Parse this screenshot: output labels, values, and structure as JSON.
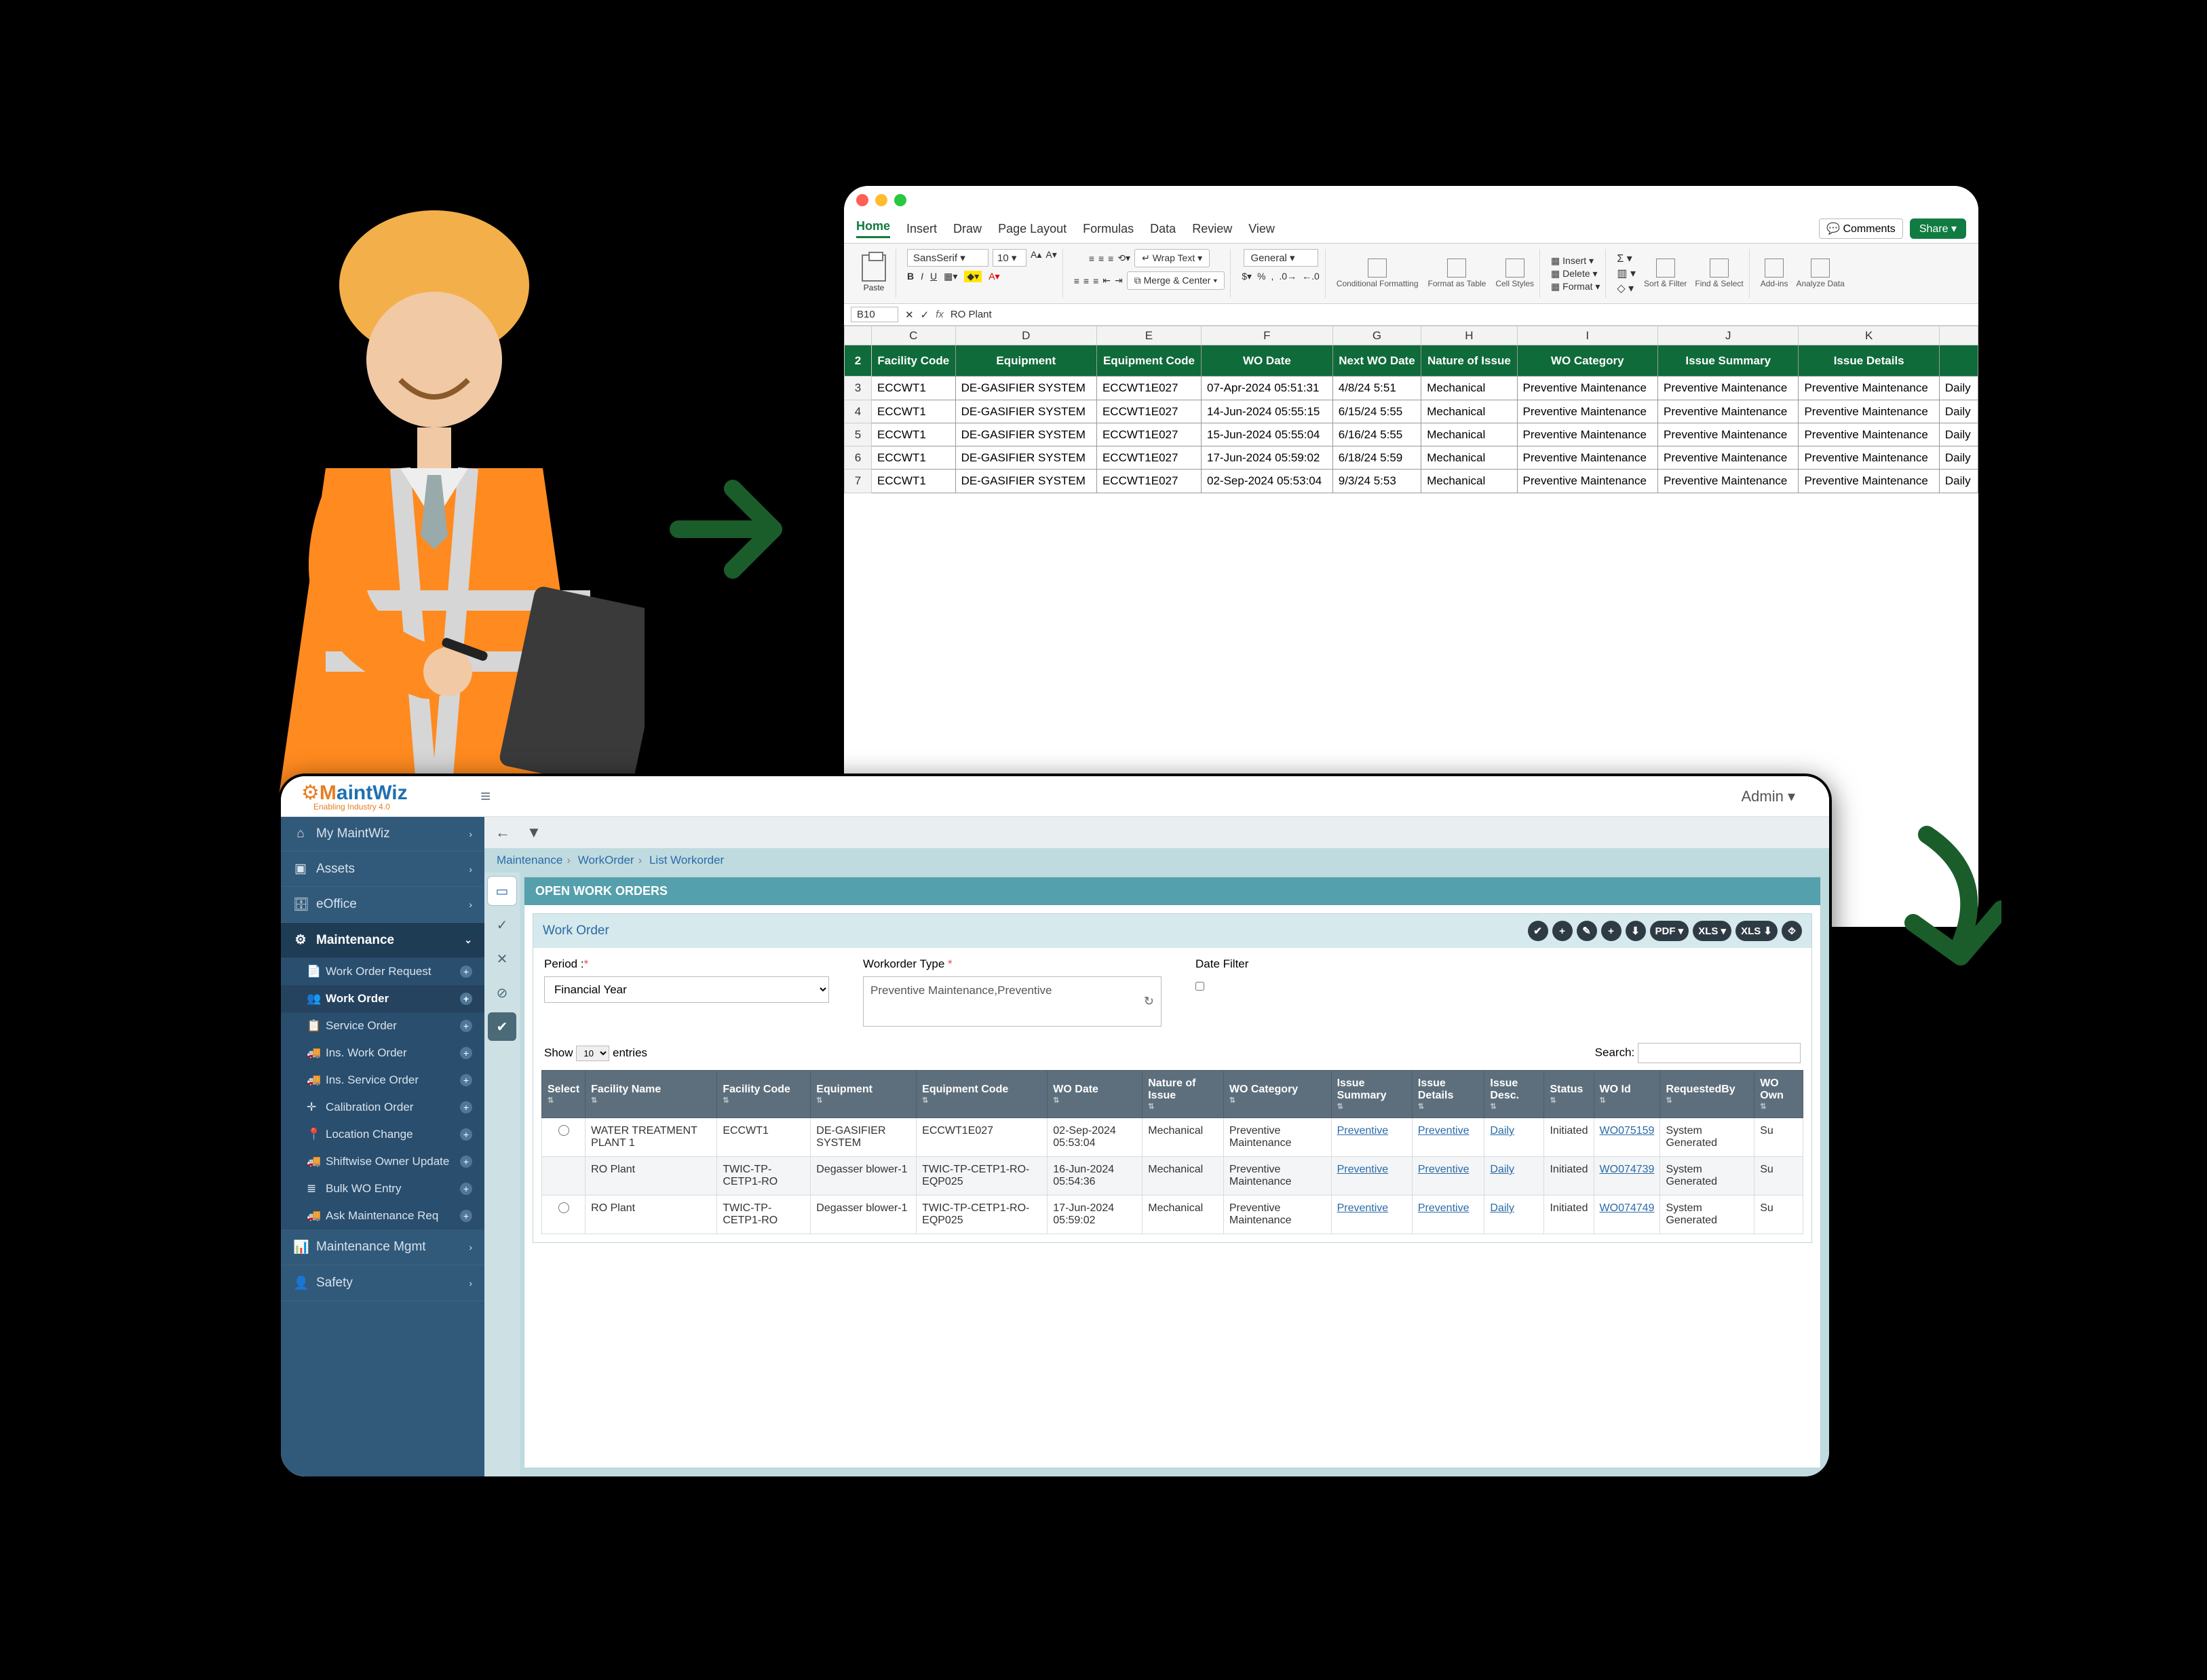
{
  "excel": {
    "tabs": [
      "Home",
      "Insert",
      "Draw",
      "Page Layout",
      "Formulas",
      "Data",
      "Review",
      "View"
    ],
    "topActions": {
      "comments": "Comments",
      "share": "Share"
    },
    "ribbon": {
      "paste": "Paste",
      "font": "SansSerif",
      "fontSize": "10",
      "wrap": "Wrap Text",
      "merge": "Merge & Center",
      "numberFormat": "General",
      "cond": "Conditional Formatting",
      "fmtTable": "Format as Table",
      "cellStyles": "Cell Styles",
      "insert": "Insert",
      "delete": "Delete",
      "format": "Format",
      "sortFilter": "Sort & Filter",
      "findSelect": "Find & Select",
      "addins": "Add-ins",
      "analyze": "Analyze Data"
    },
    "formulaBar": {
      "nameBox": "B10",
      "fx": "fx",
      "value": "RO Plant"
    },
    "columns": [
      "",
      "C",
      "D",
      "E",
      "F",
      "G",
      "H",
      "I",
      "J",
      "K",
      ""
    ],
    "headerRow": [
      "Facility Code",
      "Equipment",
      "Equipment Code",
      "WO Date",
      "Next WO Date",
      "Nature of Issue",
      "WO Category",
      "Issue Summary",
      "Issue Details",
      ""
    ],
    "rows": [
      {
        "n": "3",
        "c": [
          "ECCWT1",
          "DE-GASIFIER SYSTEM",
          "ECCWT1E027",
          "07-Apr-2024 05:51:31",
          "4/8/24 5:51",
          "Mechanical",
          "Preventive Maintenance",
          "Preventive Maintenance",
          "Preventive Maintenance",
          "Daily"
        ]
      },
      {
        "n": "4",
        "c": [
          "ECCWT1",
          "DE-GASIFIER SYSTEM",
          "ECCWT1E027",
          "14-Jun-2024 05:55:15",
          "6/15/24 5:55",
          "Mechanical",
          "Preventive Maintenance",
          "Preventive Maintenance",
          "Preventive Maintenance",
          "Daily"
        ]
      },
      {
        "n": "5",
        "c": [
          "ECCWT1",
          "DE-GASIFIER SYSTEM",
          "ECCWT1E027",
          "15-Jun-2024 05:55:04",
          "6/16/24 5:55",
          "Mechanical",
          "Preventive Maintenance",
          "Preventive Maintenance",
          "Preventive Maintenance",
          "Daily"
        ]
      },
      {
        "n": "6",
        "c": [
          "ECCWT1",
          "DE-GASIFIER SYSTEM",
          "ECCWT1E027",
          "17-Jun-2024 05:59:02",
          "6/18/24 5:59",
          "Mechanical",
          "Preventive Maintenance",
          "Preventive Maintenance",
          "Preventive Maintenance",
          "Daily"
        ]
      },
      {
        "n": "7",
        "c": [
          "ECCWT1",
          "DE-GASIFIER SYSTEM",
          "ECCWT1E027",
          "02-Sep-2024 05:53:04",
          "9/3/24 5:53",
          "Mechanical",
          "Preventive Maintenance",
          "Preventive Maintenance",
          "Preventive Maintenance",
          "Daily"
        ]
      }
    ]
  },
  "app": {
    "logo": {
      "brand1": "M",
      "brand2": "aint",
      "brand3": "Wiz",
      "tagline": "Enabling Industry 4.0"
    },
    "admin": "Admin",
    "sidebar": {
      "items": [
        {
          "icon": "home-icon",
          "label": "My MaintWiz",
          "chev": "›"
        },
        {
          "icon": "cubes-icon",
          "label": "Assets",
          "chev": "›"
        },
        {
          "icon": "briefcase-icon",
          "label": "eOffice",
          "chev": "›"
        }
      ],
      "active": {
        "icon": "gear-icon",
        "label": "Maintenance",
        "chev": "⌄"
      },
      "subs": [
        {
          "icon": "doc-icon",
          "label": "Work Order Request"
        },
        {
          "icon": "users-icon",
          "label": "Work Order",
          "current": true
        },
        {
          "icon": "clipboard-icon",
          "label": "Service Order"
        },
        {
          "icon": "truck-icon",
          "label": "Ins. Work Order"
        },
        {
          "icon": "truck-icon",
          "label": "Ins. Service Order"
        },
        {
          "icon": "target-icon",
          "label": "Calibration Order"
        },
        {
          "icon": "pin-icon",
          "label": "Location Change"
        },
        {
          "icon": "truck-icon",
          "label": "Shiftwise Owner Update"
        },
        {
          "icon": "stack-icon",
          "label": "Bulk WO Entry"
        },
        {
          "icon": "truck-icon",
          "label": "Ask Maintenance Req"
        }
      ],
      "footer": [
        {
          "icon": "chart-icon",
          "label": "Maintenance Mgmt",
          "chev": "›"
        },
        {
          "icon": "user-icon",
          "label": "Safety",
          "chev": "›"
        }
      ]
    },
    "toolbarIcons": [
      "←",
      "⯑"
    ],
    "breadcrumb": [
      "Maintenance",
      "WorkOrder",
      "List Workorder"
    ],
    "leftTabs": [
      "▭",
      "✓",
      "✕",
      "⊘",
      "✔"
    ],
    "panelTitle": "OPEN WORK ORDERS",
    "card": {
      "title": "Work Order",
      "actions": [
        "✔",
        "+",
        "✎",
        "+",
        "⬇",
        "PDF ▾",
        "XLS ▾",
        "XLS ⬇",
        "⯑"
      ],
      "periodLabel": "Period :",
      "periodValue": "Financial Year",
      "woTypeLabel": "Workorder Type",
      "woTypeValue": "Preventive Maintenance,Preventive",
      "dateFilterLabel": "Date Filter",
      "showLabel": "Show",
      "showValue": "10",
      "entriesLabel": "entries",
      "searchLabel": "Search:"
    },
    "grid": {
      "headers": [
        "Select",
        "Facility Name",
        "Facility Code",
        "Equipment",
        "Equipment Code",
        "WO Date",
        "Nature of Issue",
        "WO Category",
        "Issue Summary",
        "Issue Details",
        "Issue Desc.",
        "Status",
        "WO Id",
        "RequestedBy",
        "WO Own"
      ],
      "rows": [
        {
          "sel": true,
          "cells": [
            "WATER TREATMENT PLANT 1",
            "ECCWT1",
            "DE-GASIFIER SYSTEM",
            "ECCWT1E027",
            "02-Sep-2024 05:53:04",
            "Mechanical",
            "Preventive Maintenance",
            "Preventive",
            "Preventive",
            "Daily",
            "Initiated",
            "WO075159",
            "System Generated",
            "Su"
          ],
          "links": [
            7,
            8,
            9,
            11
          ]
        },
        {
          "sel": false,
          "cells": [
            "RO Plant",
            "TWIC-TP-CETP1-RO",
            "Degasser blower-1",
            "TWIC-TP-CETP1-RO-EQP025",
            "16-Jun-2024 05:54:36",
            "Mechanical",
            "Preventive Maintenance",
            "Preventive",
            "Preventive",
            "Daily",
            "Initiated",
            "WO074739",
            "System Generated",
            "Su"
          ],
          "links": [
            7,
            8,
            9,
            11
          ]
        },
        {
          "sel": true,
          "cells": [
            "RO Plant",
            "TWIC-TP-CETP1-RO",
            "Degasser blower-1",
            "TWIC-TP-CETP1-RO-EQP025",
            "17-Jun-2024 05:59:02",
            "Mechanical",
            "Preventive Maintenance",
            "Preventive",
            "Preventive",
            "Daily",
            "Initiated",
            "WO074749",
            "System Generated",
            "Su"
          ],
          "links": [
            7,
            8,
            9,
            11
          ]
        }
      ]
    }
  }
}
